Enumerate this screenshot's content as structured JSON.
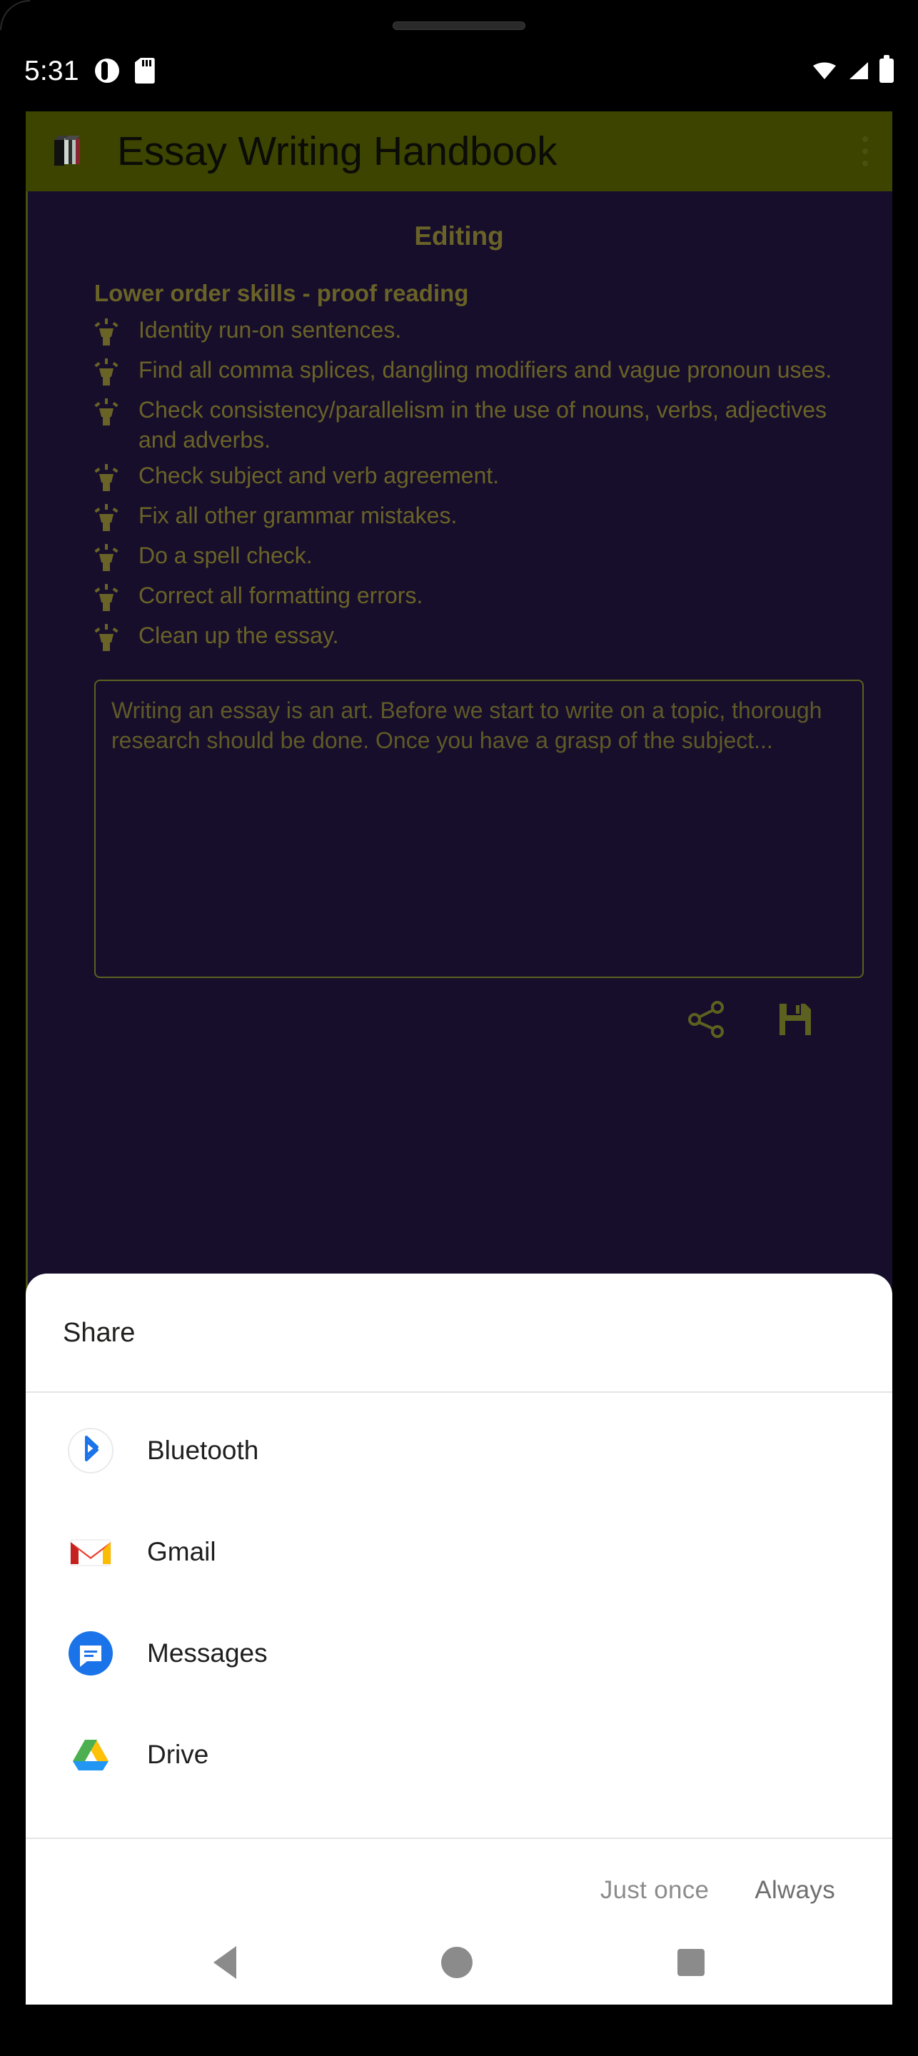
{
  "statusbar": {
    "time": "5:31",
    "left_icons": [
      "alarm-icon",
      "sd-card-icon"
    ],
    "right_icons": [
      "wifi-icon",
      "cell-signal-icon",
      "battery-icon"
    ]
  },
  "appbar": {
    "title": "Essay Writing Handbook",
    "icon": "books-icon",
    "overflow": "overflow-menu-icon",
    "bg_color": "#3d4400",
    "text_color": "#0b0b07"
  },
  "content": {
    "bg_color": "#170e2b",
    "accent_color": "#6a6327",
    "section_title": "Editing",
    "sub_title": "Lower order skills - proof reading",
    "bullet_icon": "lightbulb-icon",
    "skills": [
      "Identity run-on sentences.",
      "Find all comma splices, dangling modifiers and vague pronoun uses.",
      "Check consistency/parallelism in the use of nouns, verbs, adjectives and adverbs.",
      "Check subject and verb agreement.",
      "Fix all other grammar mistakes.",
      "Do a spell check.",
      "Correct all formatting errors.",
      "Clean up the essay."
    ],
    "essay_text": "Writing an essay is an art. Before we start to write on a topic, thorough research should be done. Once you have a grasp of the subject...",
    "actions": [
      {
        "name": "share-icon",
        "label": "Share"
      },
      {
        "name": "save-icon",
        "label": "Save"
      }
    ]
  },
  "share_sheet": {
    "title": "Share",
    "apps": [
      {
        "label": "Bluetooth",
        "icon": "bluetooth-icon",
        "color": "#2196f3"
      },
      {
        "label": "Gmail",
        "icon": "gmail-icon",
        "color": "#ea4335"
      },
      {
        "label": "Messages",
        "icon": "messages-icon",
        "color": "#1a73e8"
      },
      {
        "label": "Drive",
        "icon": "drive-icon",
        "color": "#ffc107"
      }
    ],
    "buttons": {
      "just_once": "Just once",
      "always": "Always"
    }
  },
  "navbar": {
    "back": "back-nav-button",
    "home": "home-nav-button",
    "recents": "recents-nav-button"
  }
}
